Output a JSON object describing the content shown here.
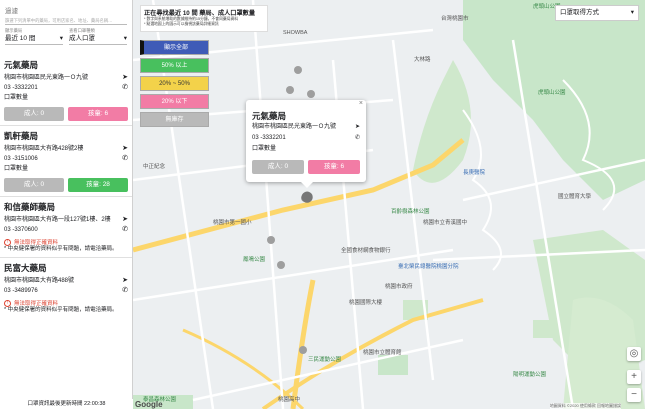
{
  "sidebar": {
    "search_label": "過濾",
    "search_placeholder": "篩選下列清單中的藥局，可用店家名、地址、藥局名稱…",
    "filter1_label": "顯示藥局",
    "filter1_value": "最近 10 間",
    "filter2_label": "查看口罩種類",
    "filter2_value": "成人口罩",
    "stores": [
      {
        "name": "元氣藥局",
        "address": "桃園市桃園區民光東路一Ｏ九號",
        "phone": "03 -3332201",
        "type": "口罩數量",
        "adult": "成人: 0",
        "child": "孩童: 6",
        "child_color": "pink",
        "warning": "",
        "note": ""
      },
      {
        "name": "凱軒藥局",
        "address": "桃園市桃園區大有路428號2樓",
        "phone": "03 -3151006",
        "type": "口罩數量",
        "adult": "成人: 0",
        "child": "孩童: 28",
        "child_color": "green",
        "warning": "",
        "note": ""
      },
      {
        "name": "和信藥師藥局",
        "address": "桃園市桃園區大有路一段127號1樓、2樓",
        "phone": "03 -3370600",
        "type": "",
        "adult": "",
        "child": "",
        "child_color": "",
        "warning": "無法取得正確資料",
        "note": "* 中央健保署的資料似乎有問題，請電洽藥局。"
      },
      {
        "name": "民富大藥局",
        "address": "桃園市桃園區大有路488號",
        "phone": "03 -3489976",
        "type": "",
        "adult": "",
        "child": "",
        "child_color": "",
        "warning": "無法取得正確資料",
        "note": "* 中央健保署的資料似乎有問題，請電洽藥局。"
      }
    ],
    "footer": "口罩資訊最後更新時間 22:00:38"
  },
  "map": {
    "info_title": "正在尋找最近 10 間 藥局、成人口罩數量",
    "info_line1": "* 數字與系統增助的數據維持約15分鐘，不會同藥局資料",
    "info_line2": "* 點選地圖上的圖示可以檢視該藥局詳細資訊",
    "legend": [
      "顯示全部",
      "50% 以上",
      "20% ~ 50%",
      "20% 以下",
      "無庫存"
    ],
    "dropdown": "口罩取得方式",
    "popup": {
      "name": "元氣藥局",
      "address": "桃園市桃園區民光東路一Ｏ九號",
      "phone": "03 -3332201",
      "type": "口罩數量",
      "adult": "成人: 0",
      "child": "孩童: 6"
    },
    "google": "Google",
    "terms": "地圖資料 ©2020  使用條款  回報地圖錯誤",
    "labels": [
      {
        "text": "虎頭山公園",
        "cls": "green"
      },
      {
        "text": "台灣桃園市",
        "cls": ""
      },
      {
        "text": "大林路",
        "cls": ""
      },
      {
        "text": "長庚醫院",
        "cls": "blue"
      },
      {
        "text": "虎頭山公園",
        "cls": "green"
      },
      {
        "text": "國立體育大學",
        "cls": ""
      },
      {
        "text": "百齡樹森林公園",
        "cls": "green"
      },
      {
        "text": "桃園市立青溪國中",
        "cls": ""
      },
      {
        "text": "臺北榮民總醫院桃園分院",
        "cls": "blue"
      },
      {
        "text": "桃園市政府",
        "cls": ""
      },
      {
        "text": "全國食材網食物銀行",
        "cls": ""
      },
      {
        "text": "桃園國際大樓",
        "cls": ""
      },
      {
        "text": "三民運動公園",
        "cls": "green"
      },
      {
        "text": "泰昌森林公園",
        "cls": "green"
      },
      {
        "text": "桃園市立體育館",
        "cls": ""
      },
      {
        "text": "鳳鳴公園",
        "cls": "green"
      },
      {
        "text": "中正紀念",
        "cls": ""
      },
      {
        "text": "桃園市第一國小",
        "cls": ""
      },
      {
        "text": "桃園高中",
        "cls": ""
      },
      {
        "text": "SHOWBA",
        "cls": ""
      },
      {
        "text": "陽明運動公園",
        "cls": "green"
      }
    ]
  }
}
